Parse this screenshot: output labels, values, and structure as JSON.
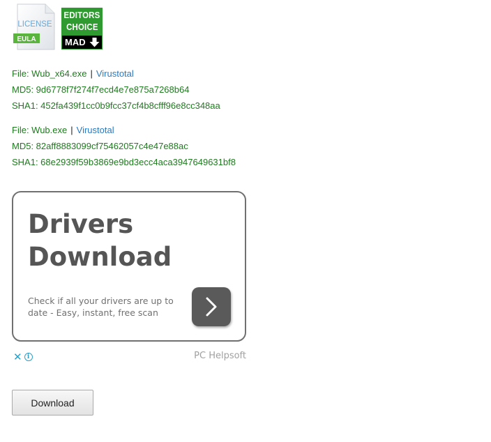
{
  "badges": {
    "license": {
      "top_text": "LICENSE",
      "tag_text": "EULA",
      "icon": "license-document-icon"
    },
    "editors_choice": {
      "line1": "EDITORS",
      "line2": "CHOICE",
      "bar_text": "MAD",
      "icon": "download-arrow-icon"
    }
  },
  "files": [
    {
      "file_label": "File: Wub_x64.exe",
      "separator": "|",
      "link_label": "Virustotal",
      "md5": "MD5: 9d6778f7f274f7ecd4e7e875a7268b64",
      "sha1": "SHA1: 452fa439f1cc0b9fcc37cf4b8cfff96e8cc348aa"
    },
    {
      "file_label": "File: Wub.exe",
      "separator": "|",
      "link_label": "Virustotal",
      "md5": "MD5: 82aff8883099cf75462057c4e47e88ac",
      "sha1": "SHA1: 68e2939f59b3869e9bd3ecc4aca3947649631bf8"
    }
  ],
  "ad": {
    "title_line1": "Drivers",
    "title_line2": "Download",
    "description": "Check if all your drivers are up to date - Easy, instant, free scan",
    "arrow_icon": "chevron-right-icon",
    "close_icon": "close-icon",
    "close_glyph": "✕",
    "info_icon": "info-icon",
    "info_glyph": "i",
    "brand": "PC Helpsoft"
  },
  "download_button": {
    "label": "Download"
  },
  "colors": {
    "green_text": "#1f7a1f",
    "link_blue": "#2a79c0",
    "badge_green": "#2e9a2f",
    "ad_grey": "#555555"
  }
}
